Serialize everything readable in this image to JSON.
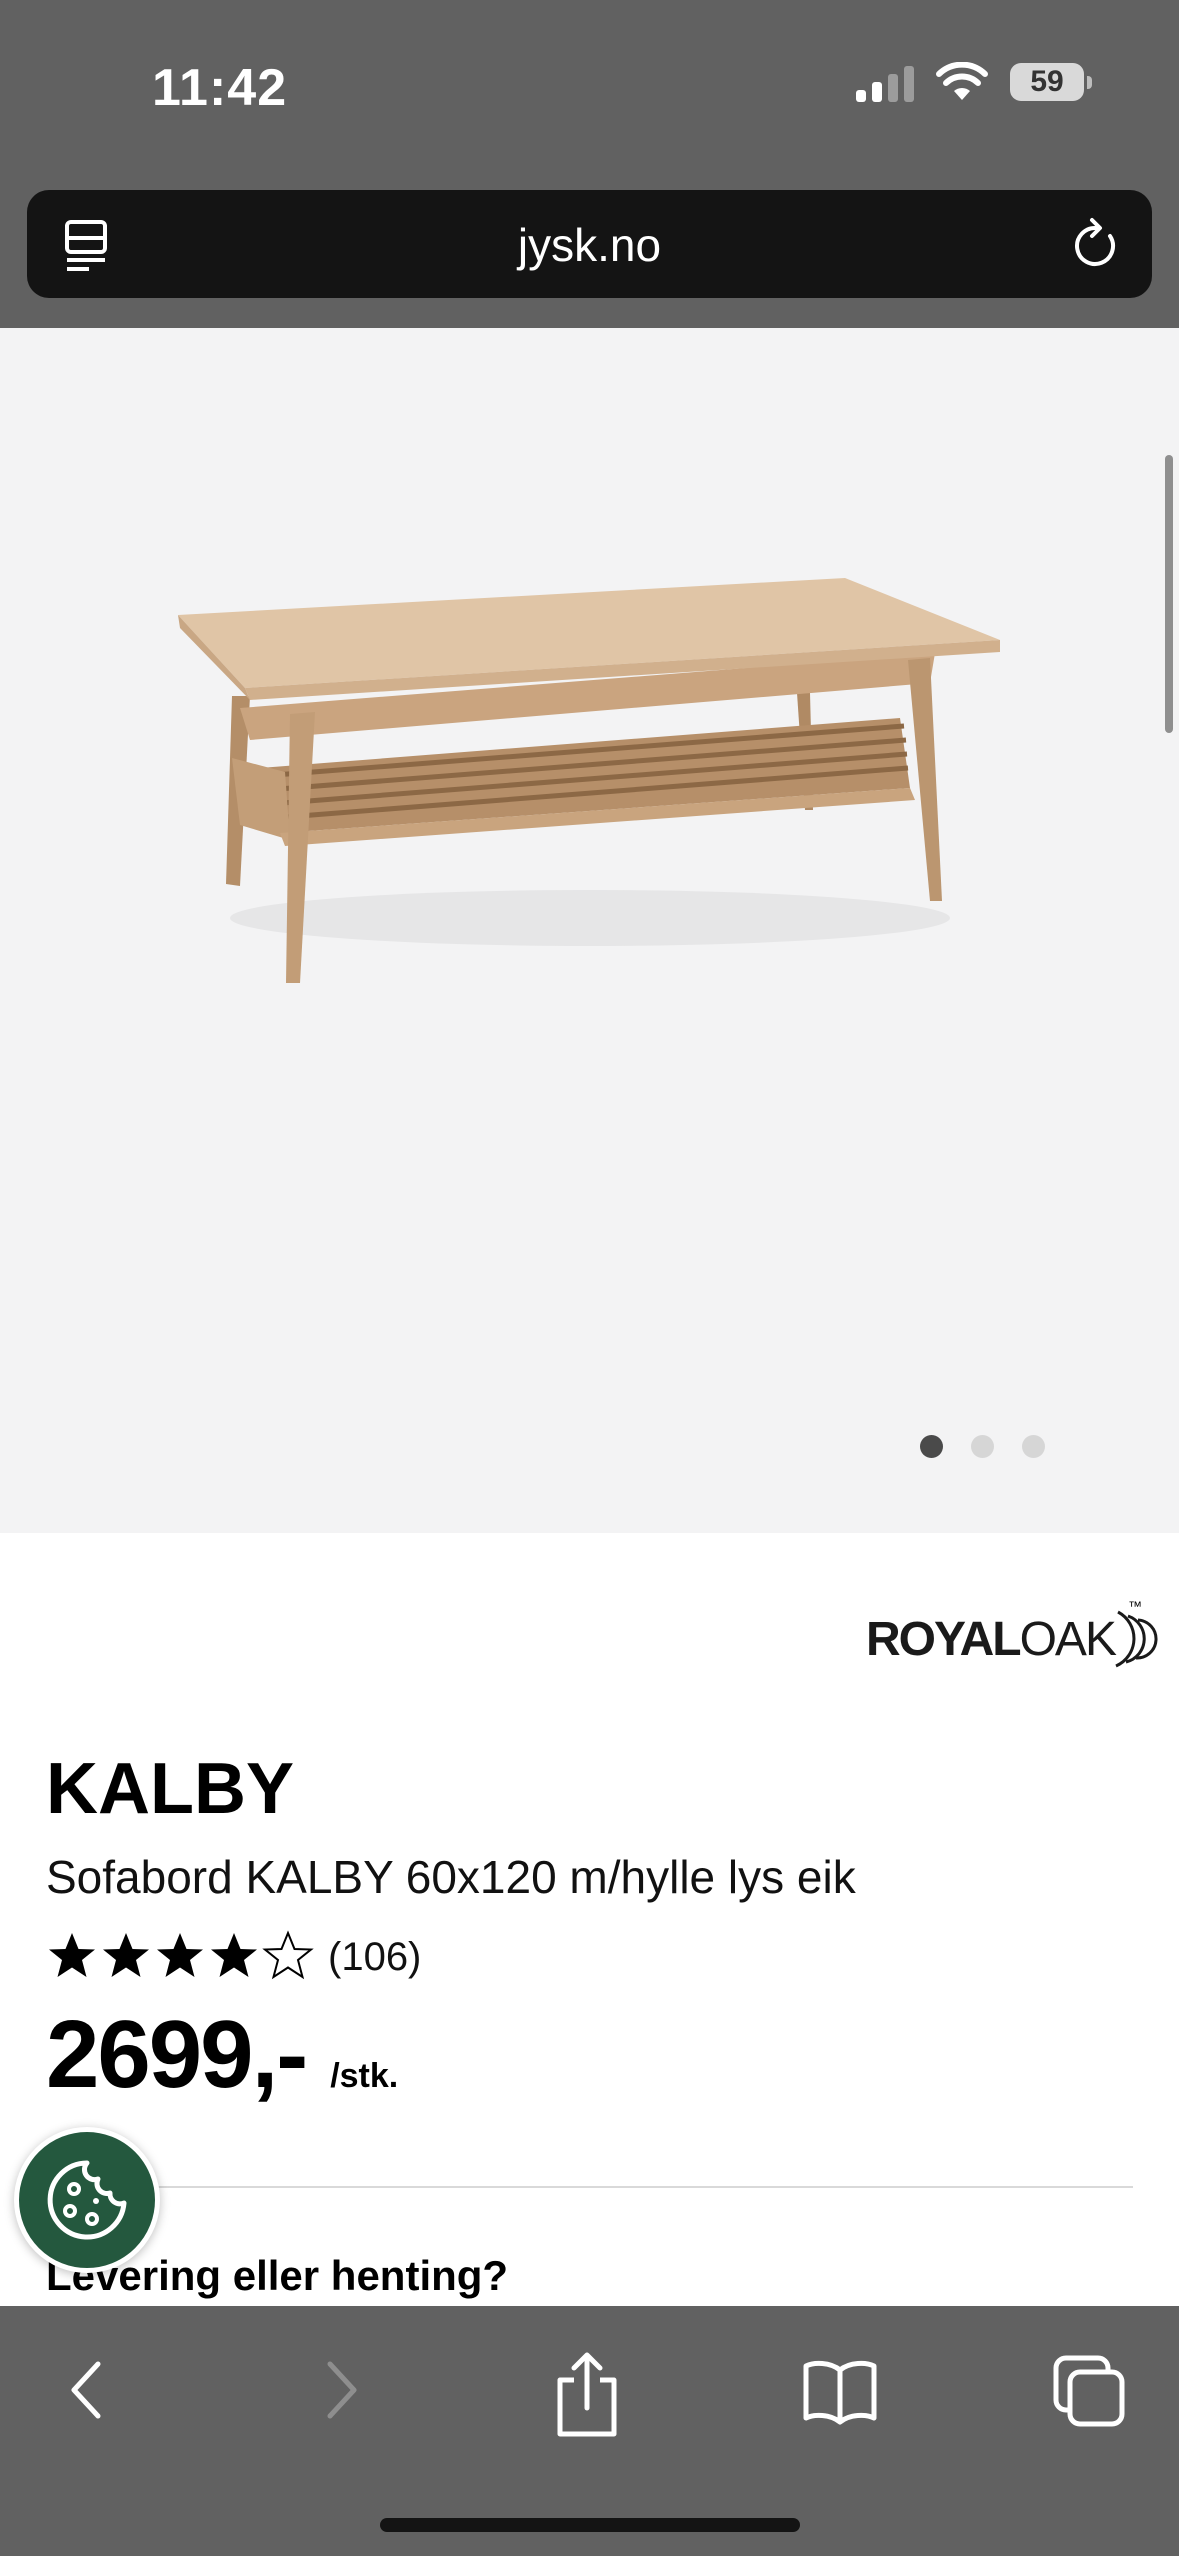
{
  "status_bar": {
    "time": "11:42",
    "battery": "59"
  },
  "browser": {
    "url": "jysk.no"
  },
  "gallery": {
    "total": 3,
    "active": 1
  },
  "product": {
    "brand_logo_bold": "ROYAL",
    "brand_logo_light": "OAK",
    "brand_logo_tm": "™",
    "name": "KALBY",
    "subtitle": "Sofabord KALBY 60x120 m/hylle lys eik",
    "rating_stars": 4,
    "rating_max": 5,
    "rating_count": "(106)",
    "price": "2699,-",
    "price_unit": "/stk.",
    "delivery_heading": "Levering eller henting?"
  },
  "colors": {
    "brand_green": "#24583e",
    "chrome_gray": "#616161",
    "hero_bg": "#f3f3f4"
  },
  "toolbar_icons": [
    "back-icon",
    "forward-icon",
    "share-icon",
    "bookmarks-icon",
    "tabs-icon"
  ]
}
